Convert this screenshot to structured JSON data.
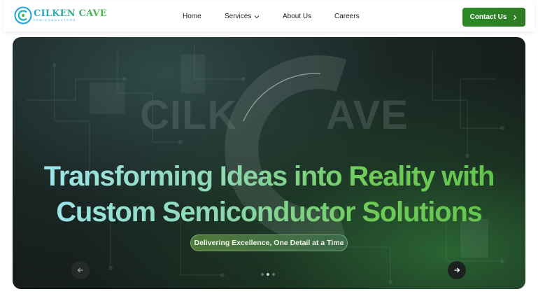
{
  "brand": {
    "logo_main": "CILKEN CAVE",
    "logo_sub": "SEMICONDUCTORS"
  },
  "nav": {
    "items": [
      {
        "label": "Home"
      },
      {
        "label": "Services"
      },
      {
        "label": "About Us"
      },
      {
        "label": "Careers"
      }
    ],
    "contact_label": "Contact Us"
  },
  "hero": {
    "watermark_left": "CILK",
    "watermark_right": "AVE",
    "headline_line1": "Transforming Ideas into Reality with",
    "headline_line2": "Custom Semiconductor Solutions",
    "tagline": "Delivering Excellence, One Detail at a Time",
    "slides_total": 3,
    "active_slide": 2
  },
  "colors": {
    "accent_green": "#2a8b26",
    "headline_cyan": "#9ee8f5",
    "headline_green": "#5fc24a"
  },
  "icons": {
    "services_dropdown": "chevron-down-icon",
    "contact_arrow": "chevron-right-icon",
    "prev": "arrow-left-icon",
    "next": "arrow-right-icon"
  }
}
